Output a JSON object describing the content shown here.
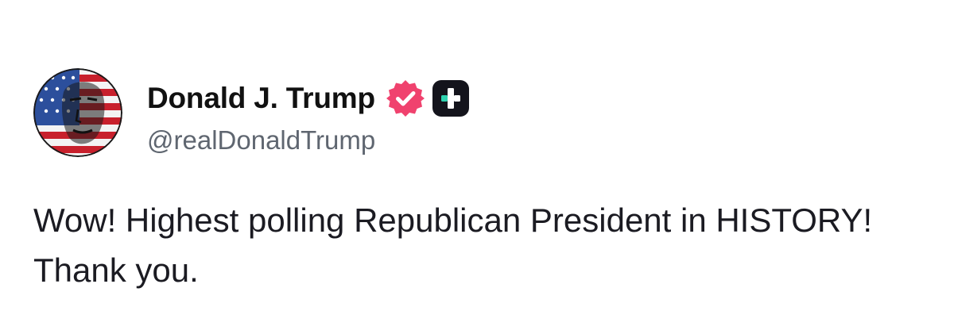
{
  "author": {
    "display_name": "Donald J. Trump",
    "handle": "@realDonaldTrump",
    "verified_icon": "verified-check-icon",
    "badge_icon": "plus-badge-icon",
    "avatar_icon": "profile-avatar"
  },
  "post": {
    "text": "Wow! Highest polling Republican President in HISTORY! Thank you."
  },
  "colors": {
    "verified": "#f0426e",
    "badge_bg": "#14141c",
    "badge_accent": "#2fd3b0",
    "handle": "#5f6670",
    "text": "#1b1b22"
  }
}
